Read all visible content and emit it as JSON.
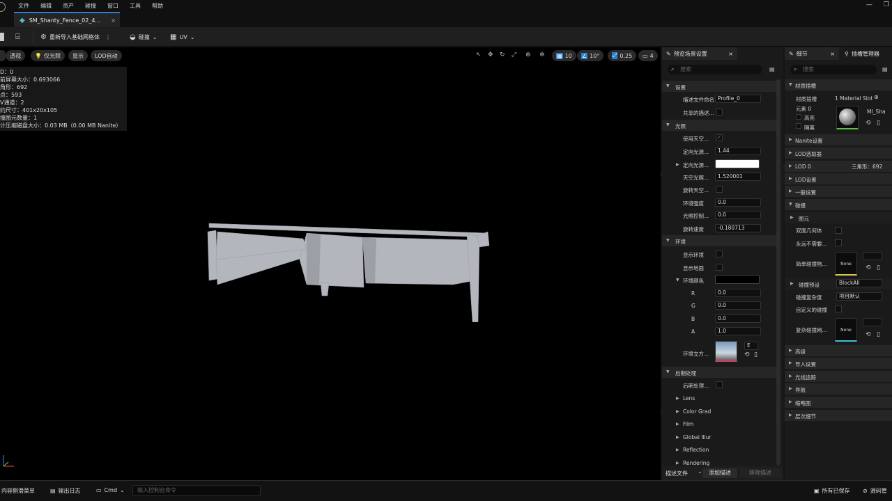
{
  "menu": [
    "文件",
    "编辑",
    "资产",
    "碰撞",
    "窗口",
    "工具",
    "帮助"
  ],
  "asset_tab": {
    "label": "SM_Shanty_Fence_02_4...",
    "close": "×"
  },
  "toolbar": {
    "reimport": "重新导入基础网格体",
    "collision": "碰撞",
    "uv": "UV"
  },
  "viewport": {
    "pills": [
      "透视",
      "仅光照",
      "显示",
      "LOD自动"
    ],
    "grid_value": "10",
    "angle_value": "10°",
    "scale_value": "0.25",
    "camera_value": "4",
    "stats": [
      "D：0",
      "前屏幕大小：0.693066",
      "角形：692",
      "点：593",
      "V通道：2",
      "约尺寸：401x20x105",
      "撞图元数量：1",
      "计压缩磁盘大小：0.03 MB（0.00 MB Nanite）"
    ]
  },
  "panel1": {
    "tab": "预览场景设置",
    "search": "搜索",
    "sections": {
      "settings": "设置",
      "light": "光照",
      "env": "环境",
      "post": "后期处理"
    },
    "rows": {
      "profile_label": "描述文件命名",
      "profile_value": "Profile_0",
      "shared": "共享的描述...",
      "use_sky": "使用天空...",
      "dir_light": "定向光源...",
      "dir_light_val": "1.44",
      "dir_color": "定向光源...",
      "sky_light": "天空光照...",
      "sky_light_val": "1.520001",
      "rotate_sky": "旋转天空...",
      "env_int": "环境强度",
      "env_int_val": "0.0",
      "light_ctrl": "光照控制...",
      "light_ctrl_val": "0.0",
      "rot_speed": "旋转速度",
      "rot_speed_val": "-0.180713",
      "show_env": "显示环境",
      "show_floor": "显示地面",
      "env_color": "环境颜色",
      "r": "R",
      "r_val": "0.0",
      "g": "G",
      "g_val": "0.0",
      "b": "B",
      "b_val": "0.0",
      "a": "A",
      "a_val": "1.0",
      "env_cube": "环境立方...",
      "cube_drop": "E",
      "post_label": "后期处理...",
      "lens": "Lens",
      "color_grad": "Color Grad",
      "film": "Film",
      "global_illum": "Global Illur",
      "reflection": "Reflection",
      "rendering": "Rendering"
    },
    "footer": {
      "profile": "描述文件",
      "add": "添加描述",
      "remove": "移除描述"
    }
  },
  "panel2": {
    "tab1": "细节",
    "tab2": "插槽管理器",
    "search": "搜索",
    "mat_section": "材质插槽",
    "mat_label": "材质插槽",
    "mat_count": "1 Material Slot",
    "element": "元素 0",
    "highlight": "高亮",
    "isolate": "隔离",
    "mat_name": "MI_Sha",
    "nanite": "Nanite设置",
    "lod_picker": "LOD选取器",
    "lod0": "LOD 0",
    "lod0_tri": "三角形：692",
    "lod_settings": "LOD设置",
    "general": "一般设置",
    "collision": "碰撞",
    "prim": "图元",
    "double_sided": "双面几何体",
    "never_need": "永远不需要...",
    "simple_coll": "简单碰撞物...",
    "none1": "None",
    "coll_preset": "碰撞预设",
    "coll_preset_val": "BlockAll",
    "coll_complex": "碰撞复杂度",
    "coll_complex_val": "项目默认",
    "custom_coll": "自定义的碰撞",
    "complex_mesh": "复杂碰撞网...",
    "none2": "None",
    "advanced": "高级",
    "import": "导入设置",
    "raytrace": "光线追踪",
    "nav": "导航",
    "thumb": "缩略图",
    "lod_detail": "层次细节"
  },
  "statusbar": {
    "drawer": "内容侧滑菜单",
    "log": "输出日志",
    "cmd": "Cmd",
    "console": "输入控制台命令",
    "saved": "所有已保存",
    "source": "源码管"
  },
  "colors": {
    "accent": "#2a7fd4",
    "check": "#3d8be0",
    "viewport_bg": "#000000",
    "mesh": "#b4b6bd"
  }
}
